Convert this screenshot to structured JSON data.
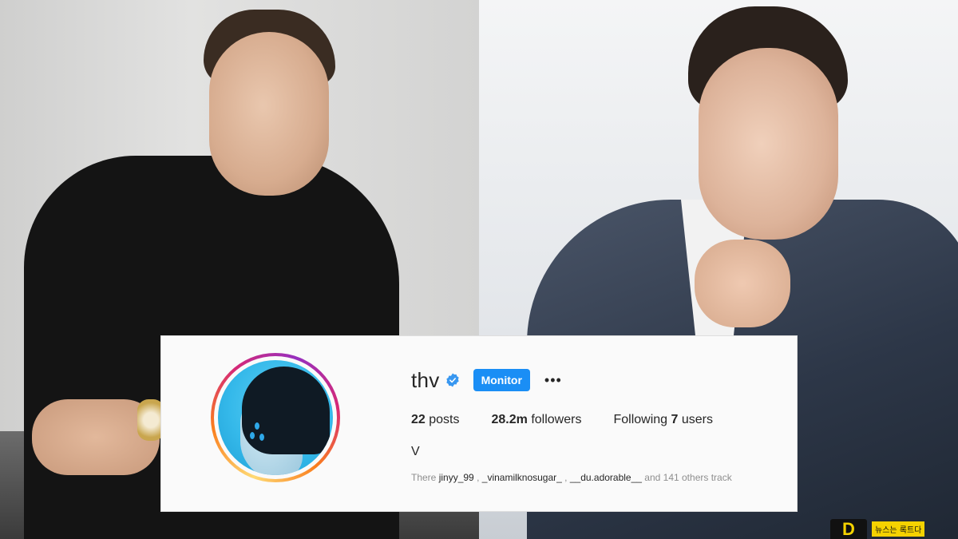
{
  "profile": {
    "username": "thv",
    "monitor_label": "Monitor",
    "more_label": "•••",
    "posts_count": "22",
    "posts_label": "posts",
    "followers_count": "28.2m",
    "followers_label": "followers",
    "following_prefix": "Following",
    "following_count": "7",
    "following_suffix": "users",
    "full_name": "V",
    "followed_by": {
      "prefix": "There",
      "user1": "jinyy_99",
      "sep1": ",",
      "user2": "_vinamilknosugar_",
      "sep2": ",",
      "user3": "__du.adorable__",
      "suffix": "and 141 others track"
    }
  },
  "watermark": {
    "logo": "D",
    "text": "뉴스는 록트다"
  },
  "colors": {
    "monitor_button": "#1a8ef5",
    "verified_badge": "#3897f0",
    "avatar_bg": "#35b9ea"
  },
  "icons": {
    "verified": "verified-badge-icon",
    "more": "more-horizontal-icon"
  }
}
